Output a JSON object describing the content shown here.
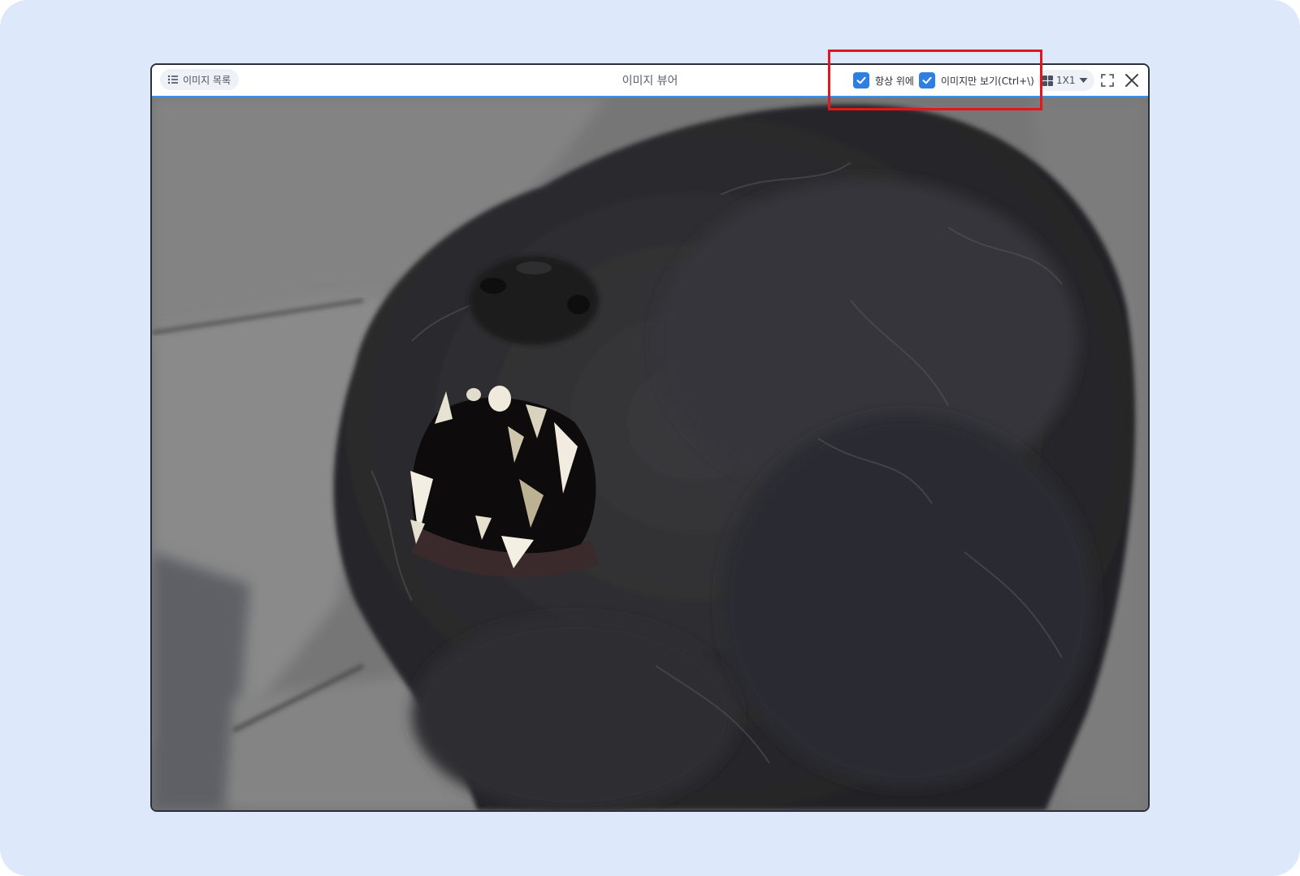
{
  "window": {
    "title": "이미지 뷰어"
  },
  "toolbar": {
    "image_list_label": "이미지 목록",
    "always_on_top_label": "항상 위에",
    "always_on_top_checked": true,
    "image_only_label": "이미지만 보기(Ctrl+\\)",
    "image_only_checked": true,
    "layout_value": "1X1"
  },
  "icons": {
    "image_list": "list-icon",
    "checkbox": "check-icon",
    "layout": "grid-icon",
    "layout_dropdown": "caret-down-icon",
    "fullscreen": "fullscreen-icon",
    "close": "close-icon"
  },
  "colors": {
    "backdrop": "#dde8fb",
    "accent": "#2f7fe2",
    "highlight": "#e3161b"
  }
}
